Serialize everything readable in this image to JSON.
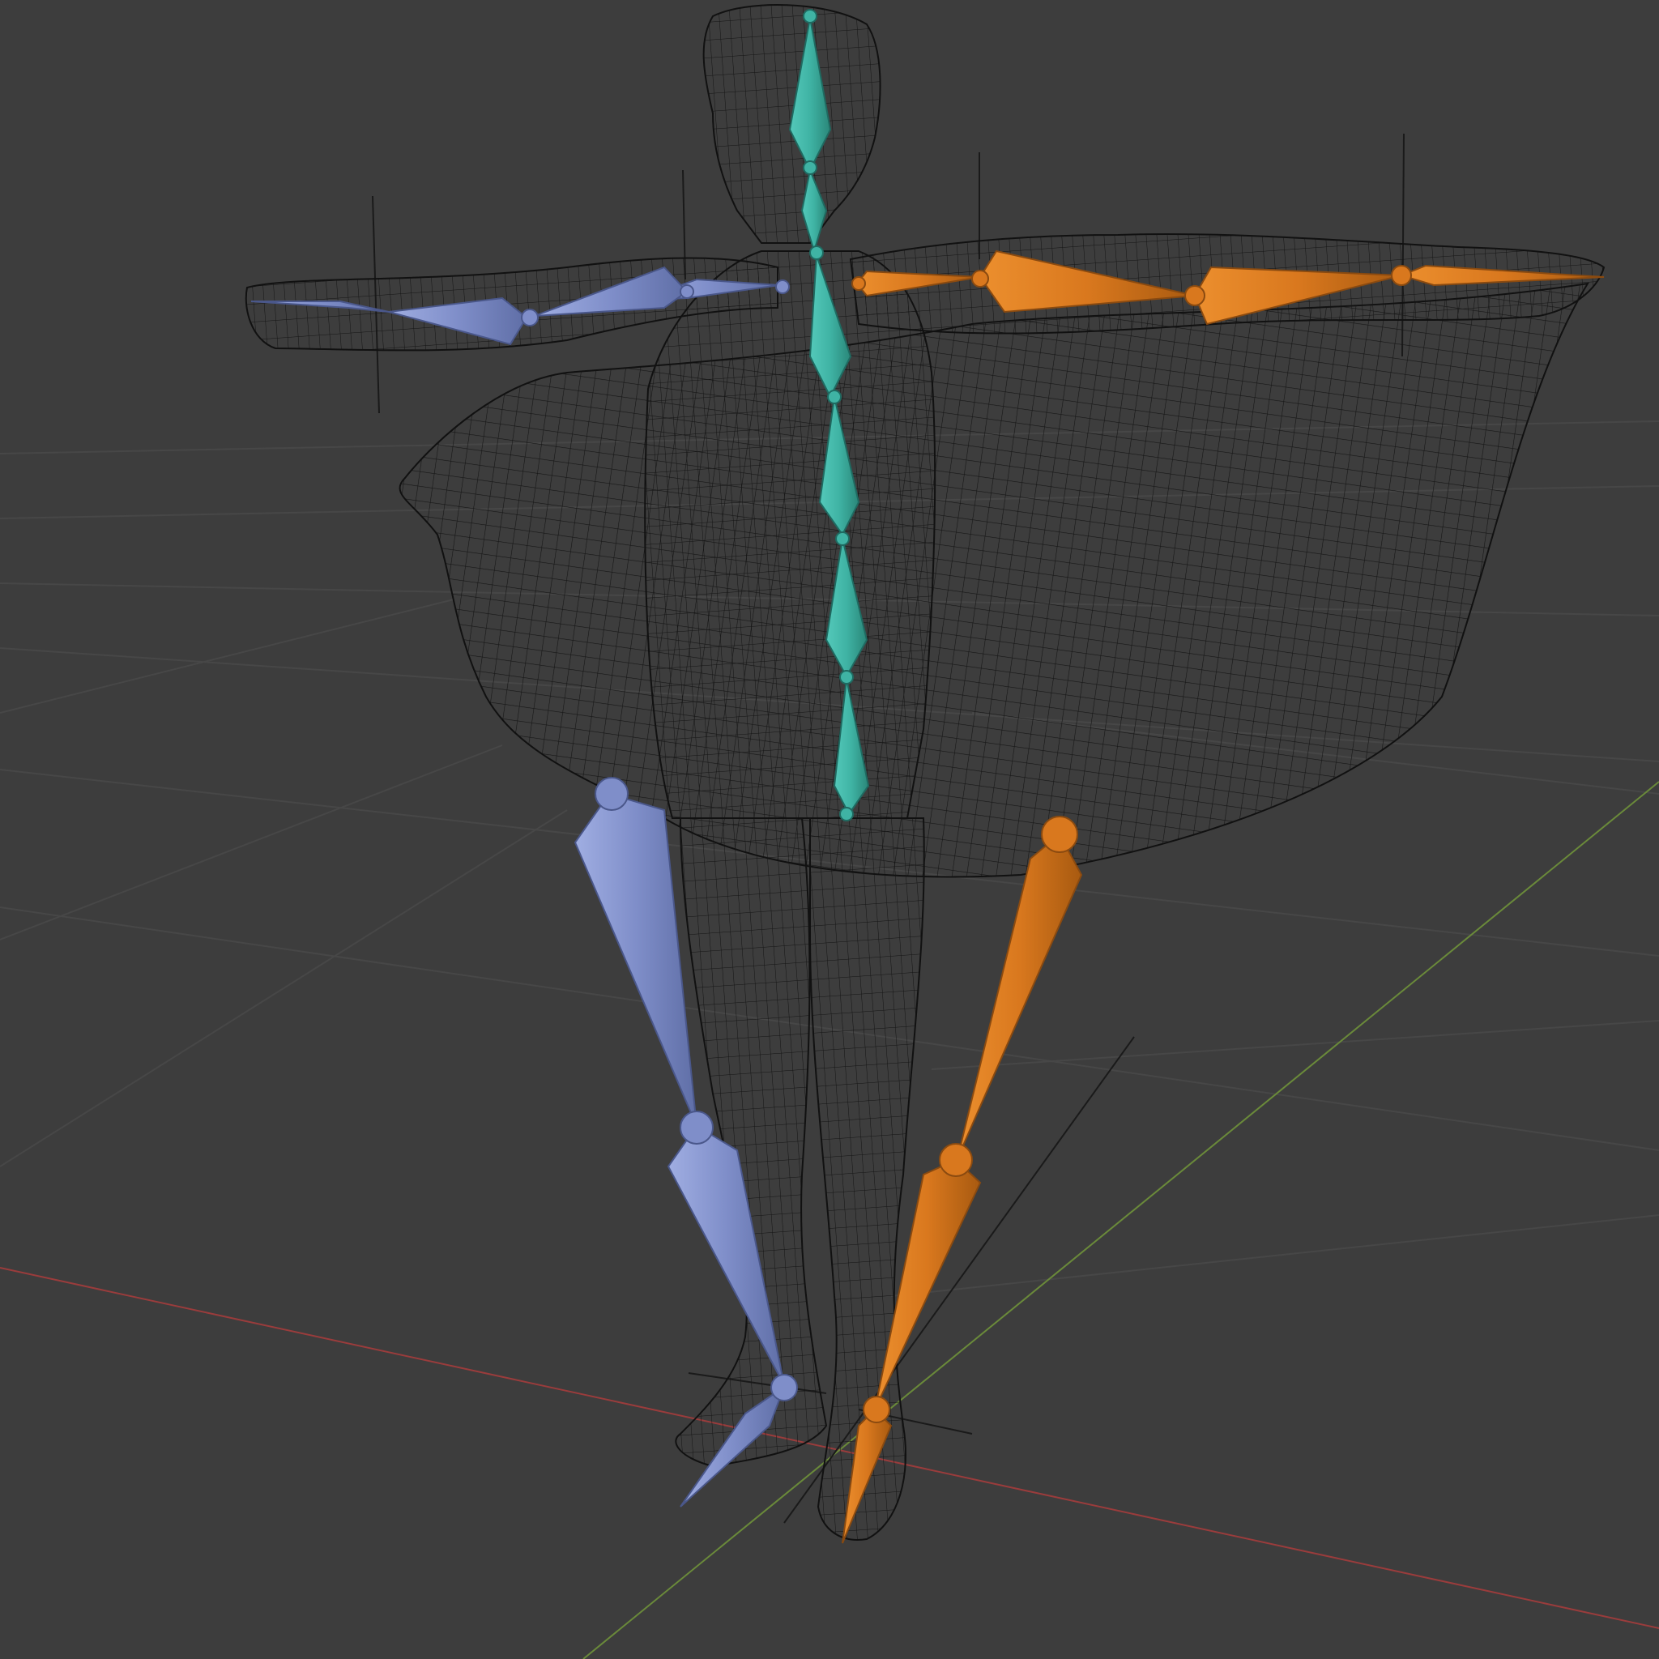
{
  "viewport": {
    "name": "3D Viewport",
    "mode": "wireframe",
    "background": "#3d3d3d"
  },
  "colors": {
    "grid_line": "#474747",
    "axis_x": "#9a3c3c",
    "axis_y": "#6a8a3a",
    "wire": "#111111",
    "bone_center": "#3fb3a4",
    "bone_left": "#7f8ec9",
    "bone_right": "#d9781e",
    "empty_marker": "#1a1a1a"
  },
  "objects": {
    "mesh": "character-mesh",
    "armature": "armature",
    "bone_groups": [
      "center",
      "left",
      "right"
    ]
  }
}
